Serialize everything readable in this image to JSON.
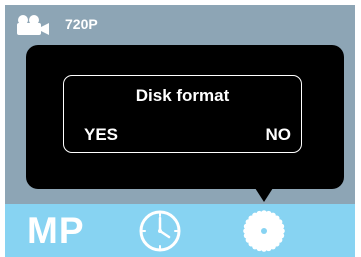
{
  "status_bar": {
    "camera_icon": "video-camera-icon",
    "resolution": "720P"
  },
  "dialog": {
    "title": "Disk format",
    "yes_label": "YES",
    "no_label": "NO"
  },
  "menu": {
    "mode_label": "MP",
    "items": [
      {
        "icon": "clock-icon"
      },
      {
        "icon": "gear-icon",
        "selected": true
      }
    ]
  },
  "colors": {
    "viewfinder": "#8da5b5",
    "menu_bar": "#87d3f2",
    "popup": "#000000",
    "text": "#ffffff"
  }
}
